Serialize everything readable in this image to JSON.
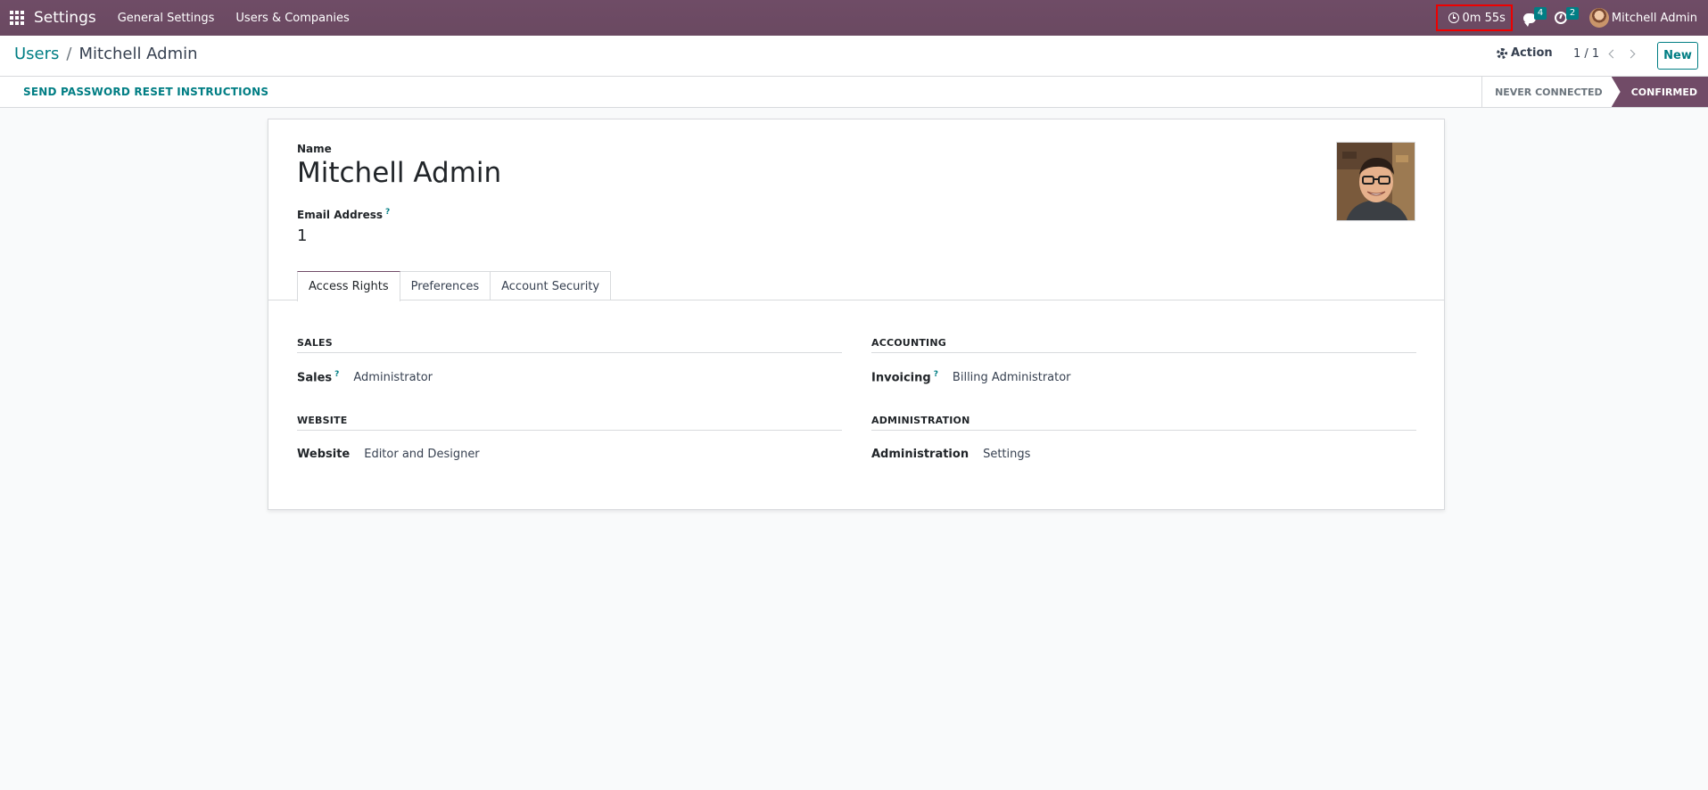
{
  "navbar": {
    "app_name": "Settings",
    "menu": [
      "General Settings",
      "Users & Companies"
    ],
    "timer": "0m 55s",
    "messages_count": "4",
    "activities_count": "2",
    "user_name": "Mitchell Admin"
  },
  "breadcrumb": {
    "parent": "Users",
    "separator": "/",
    "current": "Mitchell Admin"
  },
  "control": {
    "action_label": "Action",
    "pager": "1 / 1",
    "new_label": "New"
  },
  "statusbar": {
    "reset_label": "SEND PASSWORD RESET INSTRUCTIONS",
    "stages": [
      "NEVER CONNECTED",
      "CONFIRMED"
    ],
    "active_stage": "CONFIRMED"
  },
  "form": {
    "name_label": "Name",
    "name_value": "Mitchell Admin",
    "email_label": "Email Address",
    "email_help": "?",
    "email_value": "1",
    "tabs": [
      "Access Rights",
      "Preferences",
      "Account Security"
    ],
    "active_tab": "Access Rights",
    "groups": [
      {
        "title": "SALES",
        "label": "Sales",
        "help": "?",
        "value": "Administrator"
      },
      {
        "title": "ACCOUNTING",
        "label": "Invoicing",
        "help": "?",
        "value": "Billing Administrator"
      },
      {
        "title": "WEBSITE",
        "label": "Website",
        "help": "",
        "value": "Editor and Designer"
      },
      {
        "title": "ADMINISTRATION",
        "label": "Administration",
        "help": "",
        "value": "Settings"
      }
    ]
  },
  "colors": {
    "brand": "#714b67",
    "accent": "#017e84",
    "timer_highlight": "#ee0000"
  }
}
